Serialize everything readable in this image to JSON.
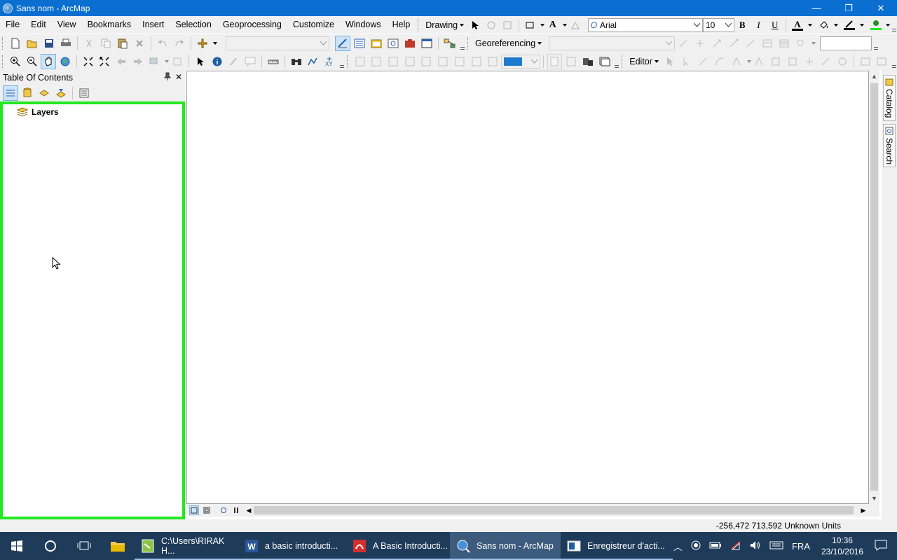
{
  "window": {
    "title": "Sans nom - ArcMap",
    "minimize": "—",
    "restore": "❐",
    "close": "✕"
  },
  "menu": [
    "File",
    "Edit",
    "View",
    "Bookmarks",
    "Insert",
    "Selection",
    "Geoprocessing",
    "Customize",
    "Windows",
    "Help"
  ],
  "drawing_toolbar": {
    "label": "Drawing",
    "font_name": "Arial",
    "font_size": "10",
    "bold": "B",
    "italic": "I",
    "underline": "U",
    "text_tool": "A",
    "font_color": "A"
  },
  "georef_toolbar": {
    "label": "Georeferencing"
  },
  "editor_toolbar": {
    "label": "Editor"
  },
  "toc": {
    "title": "Table Of Contents",
    "pin": "↕",
    "close": "✕",
    "layers_label": "Layers"
  },
  "right_dock": {
    "catalog": "Catalog",
    "search": "Search"
  },
  "status": {
    "coords": "-256,472  713,592 Unknown Units"
  },
  "taskbar": {
    "tasks": [
      {
        "label": "C:\\Users\\RIRAK H...",
        "icon": "notepad-icon"
      },
      {
        "label": "a basic introducti...",
        "icon": "word-icon"
      },
      {
        "label": "A Basic Introducti...",
        "icon": "pdf-icon"
      },
      {
        "label": "Sans nom - ArcMap",
        "icon": "arcmap-icon"
      },
      {
        "label": "Enregistreur d'acti...",
        "icon": "recorder-icon"
      }
    ],
    "lang": "FRA",
    "time": "10:36",
    "date": "23/10/2016"
  },
  "colors": {
    "accent": "#0a6fd1",
    "toc_highlight": "#22e822",
    "taskbar": "#1f3b5a"
  }
}
